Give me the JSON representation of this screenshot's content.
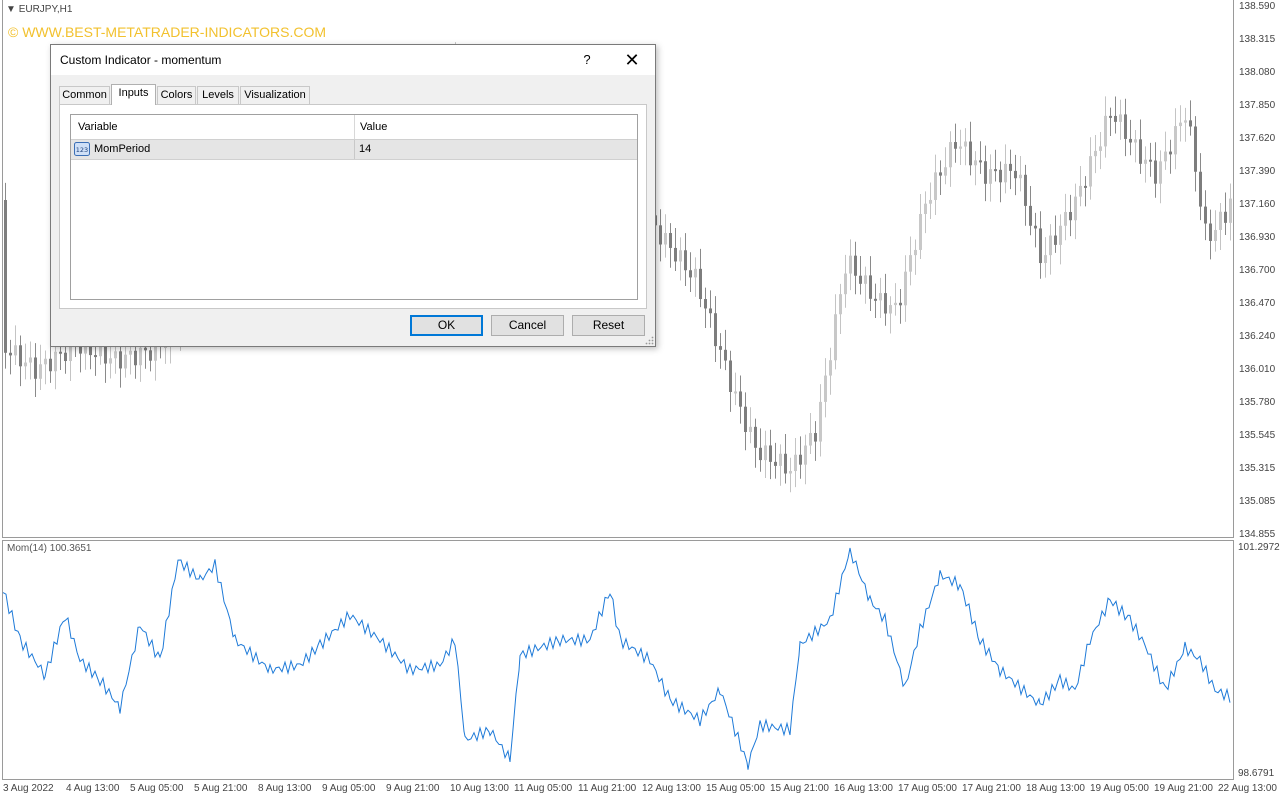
{
  "chart": {
    "symbol": "EURJPY,H1",
    "watermark": "© WWW.BEST-METATRADER-INDICATORS.COM",
    "price_axis": [
      "138.590",
      "138.315",
      "138.080",
      "137.850",
      "137.620",
      "137.390",
      "137.160",
      "136.930",
      "136.700",
      "136.470",
      "136.240",
      "136.010",
      "135.780",
      "135.545",
      "135.315",
      "135.085",
      "134.855"
    ],
    "time_axis": [
      "3 Aug 2022",
      "4 Aug 13:00",
      "5 Aug 05:00",
      "5 Aug 21:00",
      "8 Aug 13:00",
      "9 Aug 05:00",
      "9 Aug 21:00",
      "10 Aug 13:00",
      "11 Aug 05:00",
      "11 Aug 21:00",
      "12 Aug 13:00",
      "15 Aug 05:00",
      "15 Aug 21:00",
      "16 Aug 13:00",
      "17 Aug 05:00",
      "17 Aug 21:00",
      "18 Aug 13:00",
      "19 Aug 05:00",
      "19 Aug 21:00",
      "22 Aug 13:00"
    ]
  },
  "indicator": {
    "label": "Mom(14) 100.3651",
    "axis_top": "101.2972",
    "axis_bottom": "98.6791",
    "line_color": "#1e7ad8"
  },
  "dialog": {
    "title": "Custom Indicator - momentum",
    "help": "?",
    "close": "✕",
    "tabs": [
      "Common",
      "Inputs",
      "Colors",
      "Levels",
      "Visualization"
    ],
    "active_tab": "Inputs",
    "grid": {
      "headers": [
        "Variable",
        "Value"
      ],
      "rows": [
        {
          "icon": "123",
          "variable": "MomPeriod",
          "value": "14"
        }
      ]
    },
    "buttons": {
      "ok": "OK",
      "cancel": "Cancel",
      "reset": "Reset"
    }
  }
}
